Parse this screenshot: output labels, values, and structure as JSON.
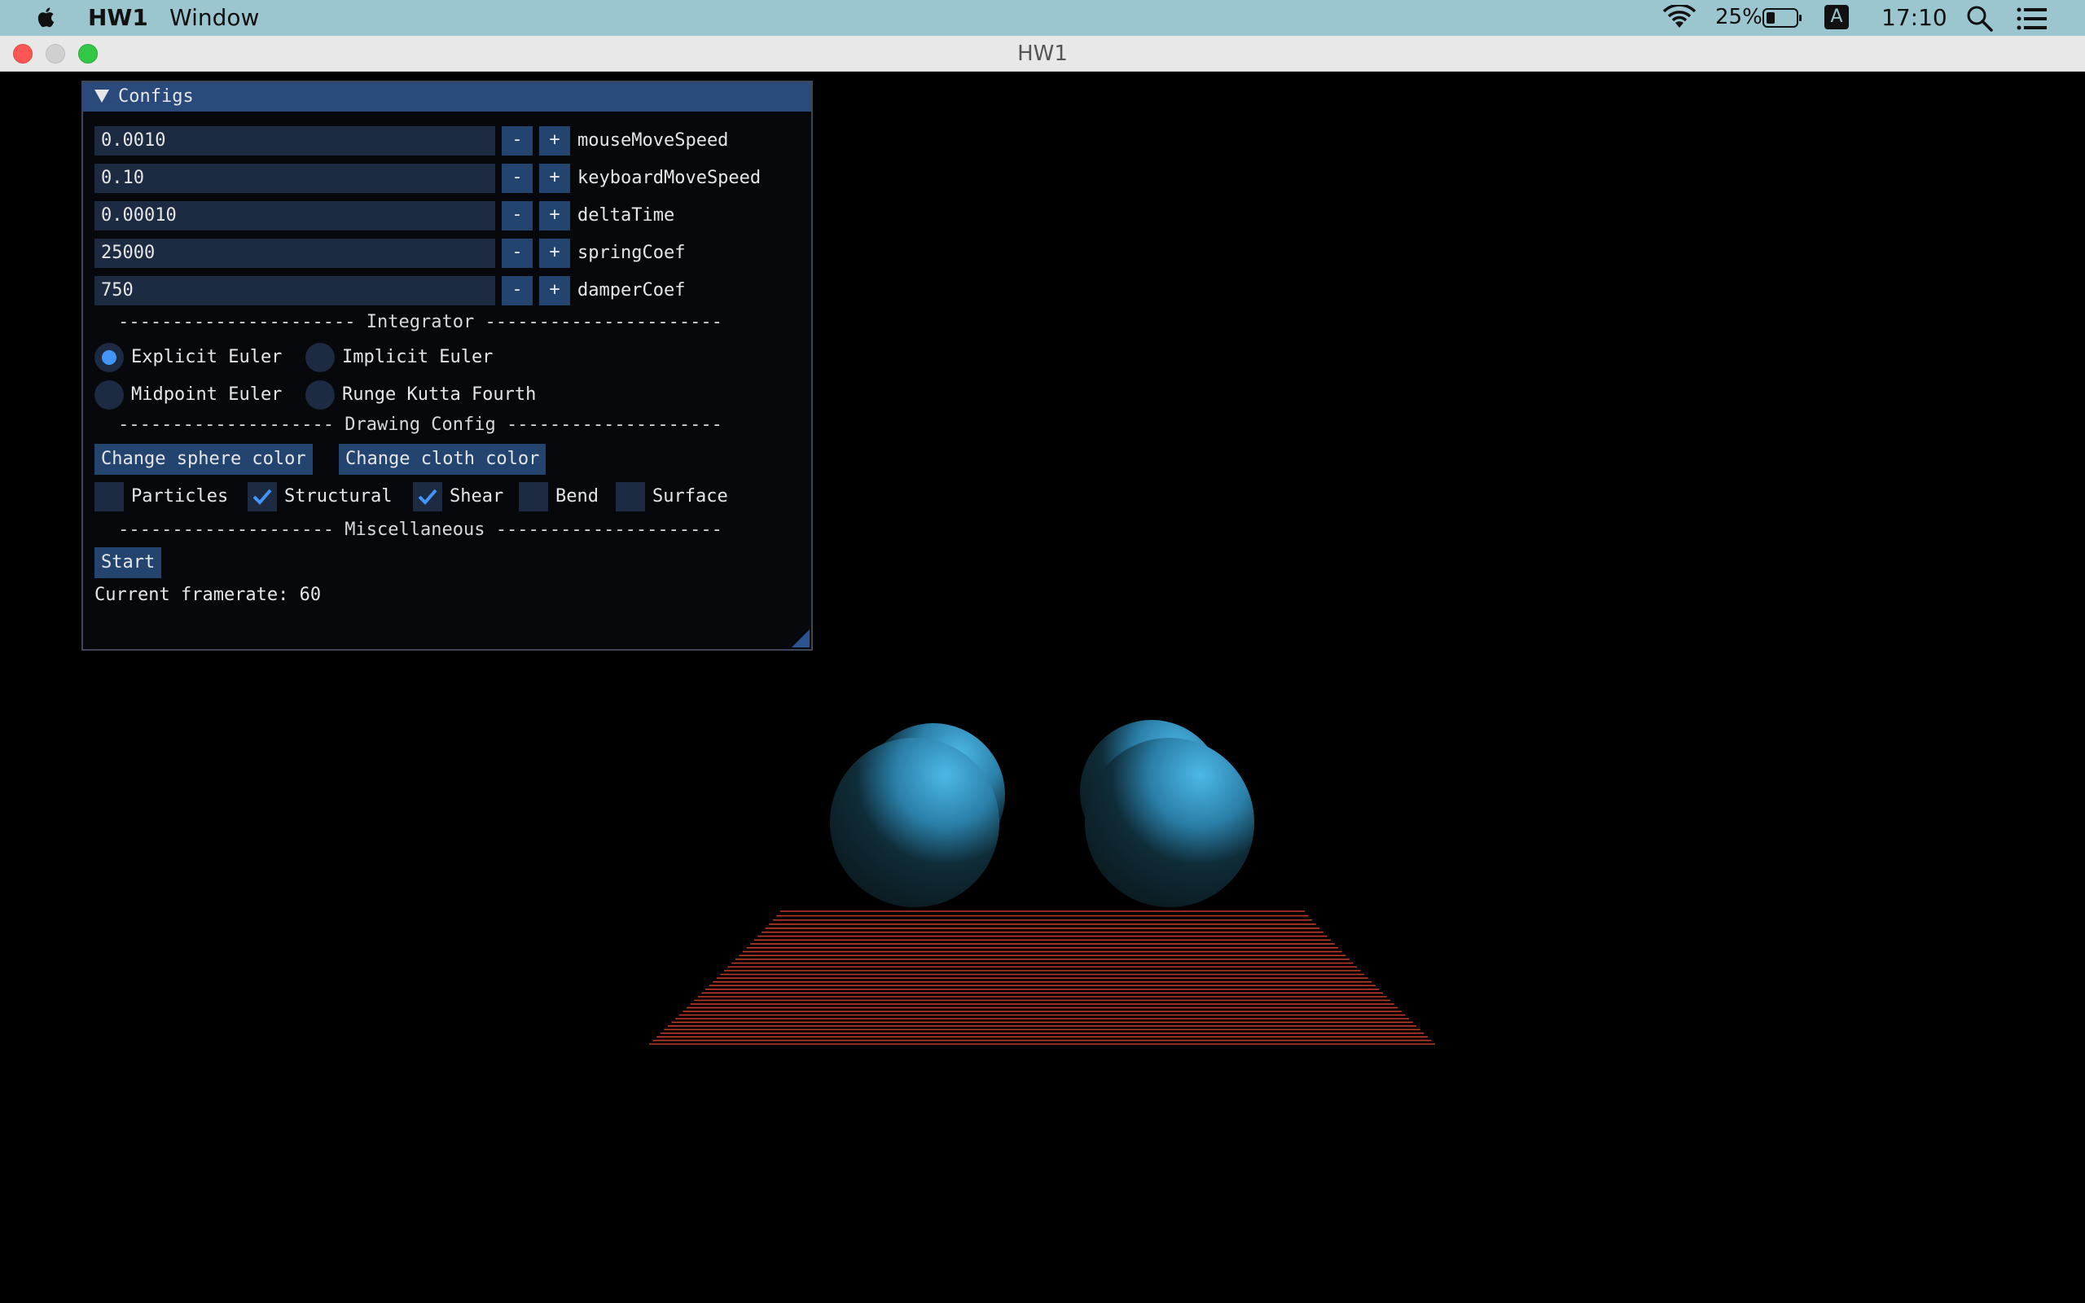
{
  "menubar": {
    "app_name": "HW1",
    "menu_window": "Window",
    "battery_percent": "25%",
    "input_source": "A",
    "clock": "17:10"
  },
  "window": {
    "title": "HW1"
  },
  "configs": {
    "header": "Configs",
    "params": [
      {
        "value": "0.0010",
        "label": "mouseMoveSpeed"
      },
      {
        "value": "0.10",
        "label": "keyboardMoveSpeed"
      },
      {
        "value": "0.00010",
        "label": "deltaTime"
      },
      {
        "value": "25000",
        "label": "springCoef"
      },
      {
        "value": "750",
        "label": "damperCoef"
      }
    ],
    "minus_label": "-",
    "plus_label": "+",
    "integrator_sep": "---------------------- Integrator ----------------------",
    "integrators": [
      {
        "label": "Explicit Euler",
        "selected": true
      },
      {
        "label": "Implicit Euler",
        "selected": false
      },
      {
        "label": "Midpoint Euler",
        "selected": false
      },
      {
        "label": "Runge Kutta Fourth",
        "selected": false
      }
    ],
    "drawing_sep": "-------------------- Drawing Config --------------------",
    "change_sphere_color": "Change sphere color",
    "change_cloth_color": "Change cloth color",
    "draw_toggles": [
      {
        "label": "Particles",
        "checked": false
      },
      {
        "label": "Structural",
        "checked": true
      },
      {
        "label": "Shear",
        "checked": true
      },
      {
        "label": "Bend",
        "checked": false
      },
      {
        "label": "Surface",
        "checked": false
      }
    ],
    "misc_sep": "-------------------- Miscellaneous ---------------------",
    "start_label": "Start",
    "framerate_text": "Current framerate: 60"
  },
  "scene": {
    "sphere_color": "#3aa6d4",
    "cloth_color": "#c0392b",
    "cloth_line_count": 36
  },
  "colors": {
    "accent": "#4296fa",
    "header_bg": "#294a7a",
    "frame_bg": "#1c2a42"
  }
}
